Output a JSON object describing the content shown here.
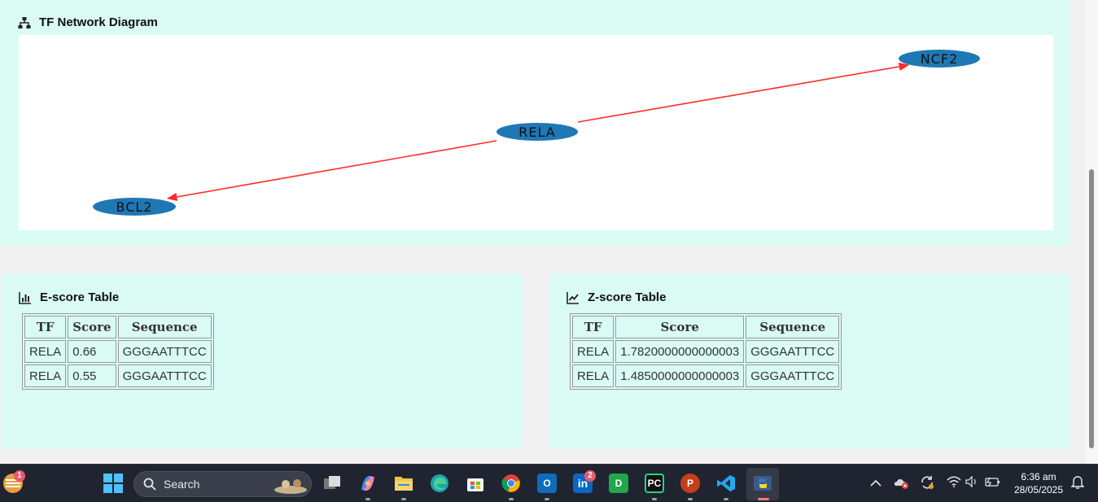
{
  "network_panel": {
    "title": "TF Network Diagram",
    "title_icon": "sitemap-icon",
    "nodes": [
      {
        "id": "BCL2",
        "label": "BCL2"
      },
      {
        "id": "RELA",
        "label": "RELA"
      },
      {
        "id": "NCF2",
        "label": "NCF2"
      }
    ],
    "edges": [
      {
        "from": "RELA",
        "to": "BCL2"
      },
      {
        "from": "RELA",
        "to": "NCF2"
      }
    ],
    "node_color": "#1f77b4",
    "edge_color": "#ff2a2a"
  },
  "escore_panel": {
    "title": "E-score Table",
    "title_icon": "bar-chart-icon",
    "headers": [
      "TF",
      "Score",
      "Sequence"
    ],
    "rows": [
      [
        "RELA",
        "0.66",
        "GGGAATTTCC"
      ],
      [
        "RELA",
        "0.55",
        "GGGAATTTCC"
      ]
    ]
  },
  "zscore_panel": {
    "title": "Z-score Table",
    "title_icon": "line-chart-icon",
    "headers": [
      "TF",
      "Score",
      "Sequence"
    ],
    "rows": [
      [
        "RELA",
        "1.7820000000000003",
        "GGGAATTTCC"
      ],
      [
        "RELA",
        "1.4850000000000003",
        "GGGAATTTCC"
      ]
    ]
  },
  "taskbar": {
    "search_label": "Search",
    "weather_badge": "1",
    "linkedin_badge": "2",
    "time": "6:36 am",
    "date": "28/05/2025",
    "apps": [
      "widgets-icon",
      "start-icon",
      "task-view-icon",
      "copilot-icon",
      "file-explorer-icon",
      "edge-icon",
      "store-icon",
      "chrome-icon",
      "outlook-icon",
      "linkedin-icon",
      "dbeaver-icon",
      "pycharm-icon",
      "powerpoint-icon",
      "vscode-icon",
      "python-icon"
    ]
  }
}
